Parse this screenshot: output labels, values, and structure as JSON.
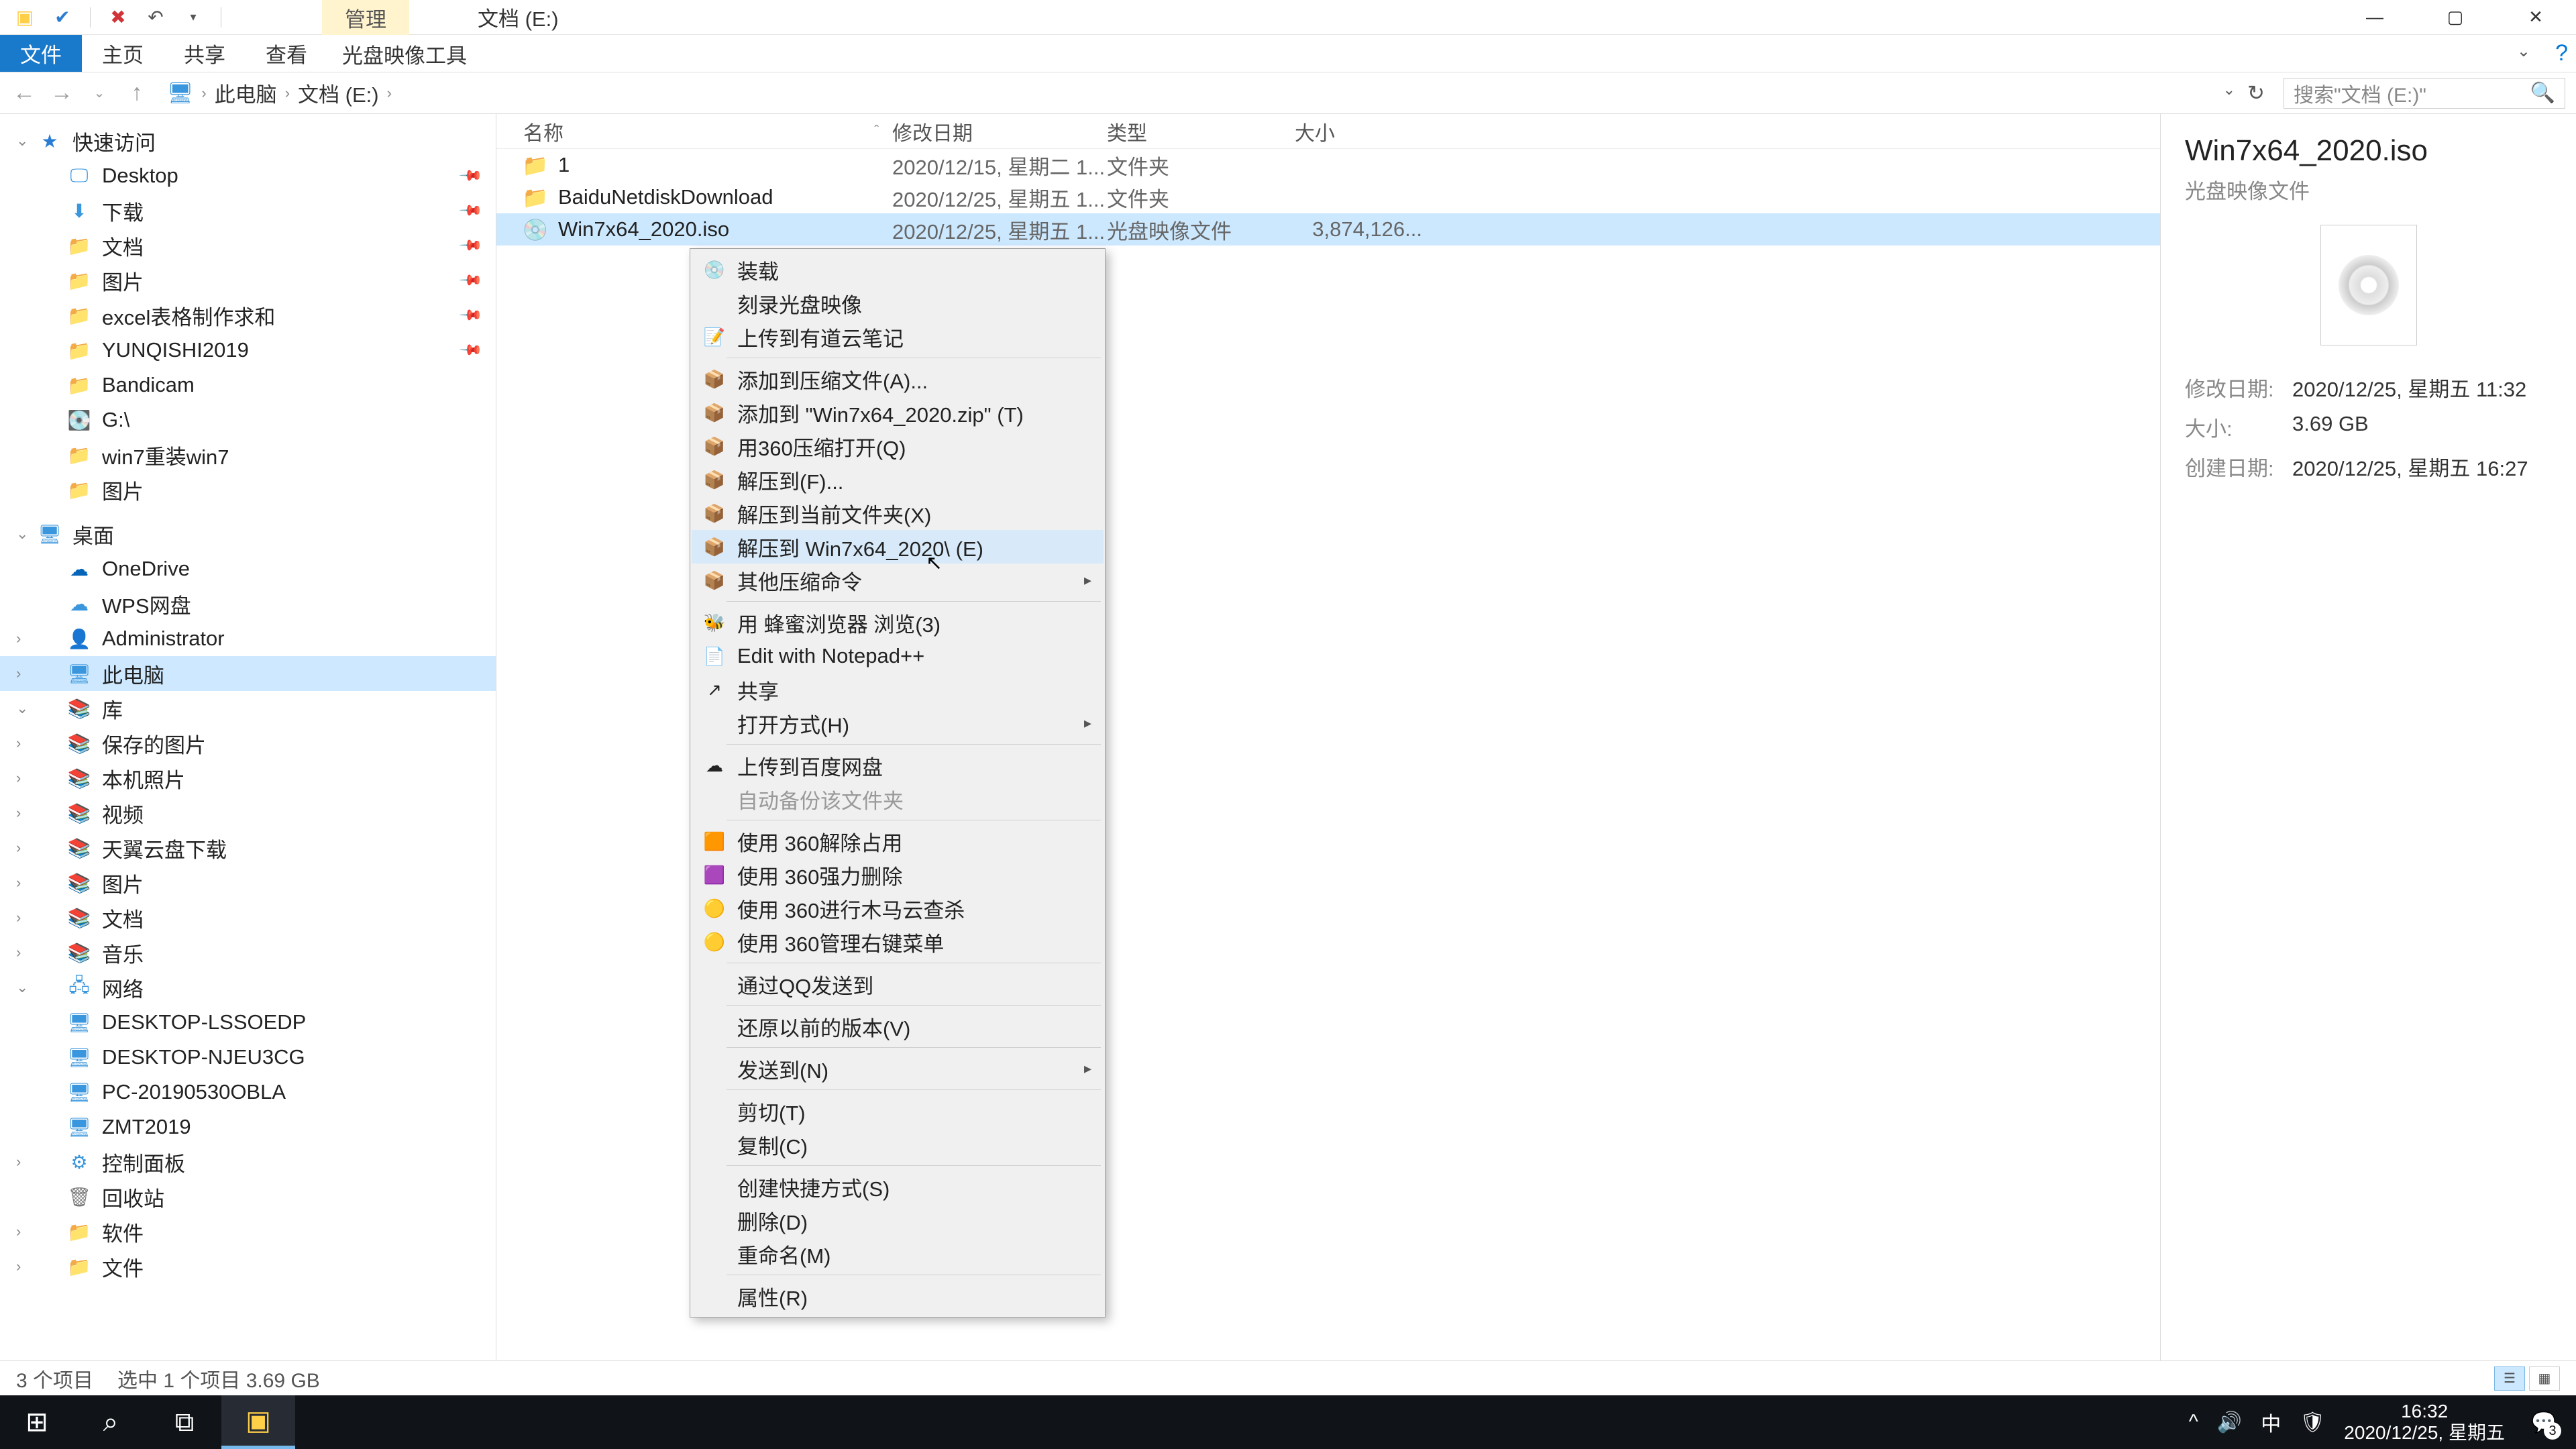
{
  "titlebar": {
    "manage_tab": "管理",
    "title": "文档 (E:)"
  },
  "ribbon": {
    "file": "文件",
    "home": "主页",
    "share": "共享",
    "view": "查看",
    "disc_tools": "光盘映像工具"
  },
  "address": {
    "crumbs": [
      "此电脑",
      "文档 (E:)"
    ],
    "search_placeholder": "搜索\"文档 (E:)\""
  },
  "sidebar": {
    "quick_access": "快速访问",
    "items_qa": [
      {
        "label": "Desktop",
        "icon": "desktop",
        "pinned": true
      },
      {
        "label": "下载",
        "icon": "download",
        "pinned": true
      },
      {
        "label": "文档",
        "icon": "folder",
        "pinned": true
      },
      {
        "label": "图片",
        "icon": "folder",
        "pinned": true
      },
      {
        "label": "excel表格制作求和",
        "icon": "folder",
        "pinned": true
      },
      {
        "label": "YUNQISHI2019",
        "icon": "folder",
        "pinned": true
      },
      {
        "label": "Bandicam",
        "icon": "folder"
      },
      {
        "label": "G:\\",
        "icon": "disk"
      },
      {
        "label": "win7重装win7",
        "icon": "folder"
      },
      {
        "label": "图片",
        "icon": "folder"
      }
    ],
    "desktop": "桌面",
    "onedrive": "OneDrive",
    "wps": "WPS网盘",
    "admin": "Administrator",
    "thispc": "此电脑",
    "libraries": "库",
    "lib_items": [
      {
        "label": "保存的图片"
      },
      {
        "label": "本机照片"
      },
      {
        "label": "视频"
      },
      {
        "label": "天翼云盘下载"
      },
      {
        "label": "图片"
      },
      {
        "label": "文档"
      },
      {
        "label": "音乐"
      }
    ],
    "network": "网络",
    "net_items": [
      {
        "label": "DESKTOP-LSSOEDP"
      },
      {
        "label": "DESKTOP-NJEU3CG"
      },
      {
        "label": "PC-20190530OBLA"
      },
      {
        "label": "ZMT2019"
      }
    ],
    "control_panel": "控制面板",
    "recycle": "回收站",
    "software": "软件",
    "files": "文件"
  },
  "columns": {
    "name": "名称",
    "date": "修改日期",
    "type": "类型",
    "size": "大小"
  },
  "files": [
    {
      "name": "1",
      "date": "2020/12/15, 星期二 1...",
      "type": "文件夹",
      "size": "",
      "icon": "folder"
    },
    {
      "name": "BaiduNetdiskDownload",
      "date": "2020/12/25, 星期五 1...",
      "type": "文件夹",
      "size": "",
      "icon": "folder"
    },
    {
      "name": "Win7x64_2020.iso",
      "date": "2020/12/25, 星期五 1...",
      "type": "光盘映像文件",
      "size": "3,874,126...",
      "icon": "iso",
      "selected": true
    }
  ],
  "details": {
    "title": "Win7x64_2020.iso",
    "subtitle": "光盘映像文件",
    "rows": [
      {
        "label": "修改日期:",
        "value": "2020/12/25, 星期五 11:32"
      },
      {
        "label": "大小:",
        "value": "3.69 GB"
      },
      {
        "label": "创建日期:",
        "value": "2020/12/25, 星期五 16:27"
      }
    ]
  },
  "context_menu": {
    "groups": [
      [
        {
          "label": "装载",
          "icon": "disc"
        },
        {
          "label": "刻录光盘映像",
          "icon": ""
        },
        {
          "label": "上传到有道云笔记",
          "icon": "note"
        }
      ],
      [
        {
          "label": "添加到压缩文件(A)...",
          "icon": "zip"
        },
        {
          "label": "添加到 \"Win7x64_2020.zip\" (T)",
          "icon": "zip"
        },
        {
          "label": "用360压缩打开(Q)",
          "icon": "zip"
        },
        {
          "label": "解压到(F)...",
          "icon": "zip"
        },
        {
          "label": "解压到当前文件夹(X)",
          "icon": "zip"
        },
        {
          "label": "解压到 Win7x64_2020\\ (E)",
          "icon": "zip",
          "hover": true
        },
        {
          "label": "其他压缩命令",
          "icon": "zip",
          "submenu": true
        }
      ],
      [
        {
          "label": "用 蜂蜜浏览器 浏览(3)",
          "icon": "bee"
        },
        {
          "label": "Edit with Notepad++",
          "icon": "npp"
        },
        {
          "label": "共享",
          "icon": "share"
        },
        {
          "label": "打开方式(H)",
          "icon": "",
          "submenu": true
        }
      ],
      [
        {
          "label": "上传到百度网盘",
          "icon": "baidu"
        },
        {
          "label": "自动备份该文件夹",
          "icon": "",
          "disabled": true
        }
      ],
      [
        {
          "label": "使用 360解除占用",
          "icon": "360a"
        },
        {
          "label": "使用 360强力删除",
          "icon": "360b"
        },
        {
          "label": "使用 360进行木马云查杀",
          "icon": "360c"
        },
        {
          "label": "使用 360管理右键菜单",
          "icon": "360c"
        }
      ],
      [
        {
          "label": "通过QQ发送到",
          "icon": ""
        }
      ],
      [
        {
          "label": "还原以前的版本(V)",
          "icon": ""
        }
      ],
      [
        {
          "label": "发送到(N)",
          "icon": "",
          "submenu": true
        }
      ],
      [
        {
          "label": "剪切(T)",
          "icon": ""
        },
        {
          "label": "复制(C)",
          "icon": ""
        }
      ],
      [
        {
          "label": "创建快捷方式(S)",
          "icon": ""
        },
        {
          "label": "删除(D)",
          "icon": ""
        },
        {
          "label": "重命名(M)",
          "icon": ""
        }
      ],
      [
        {
          "label": "属性(R)",
          "icon": ""
        }
      ]
    ]
  },
  "statusbar": {
    "count": "3 个项目",
    "selected": "选中 1 个项目  3.69 GB"
  },
  "taskbar": {
    "time": "16:32",
    "date": "2020/12/25, 星期五",
    "notif_count": "3",
    "ime": "中"
  }
}
